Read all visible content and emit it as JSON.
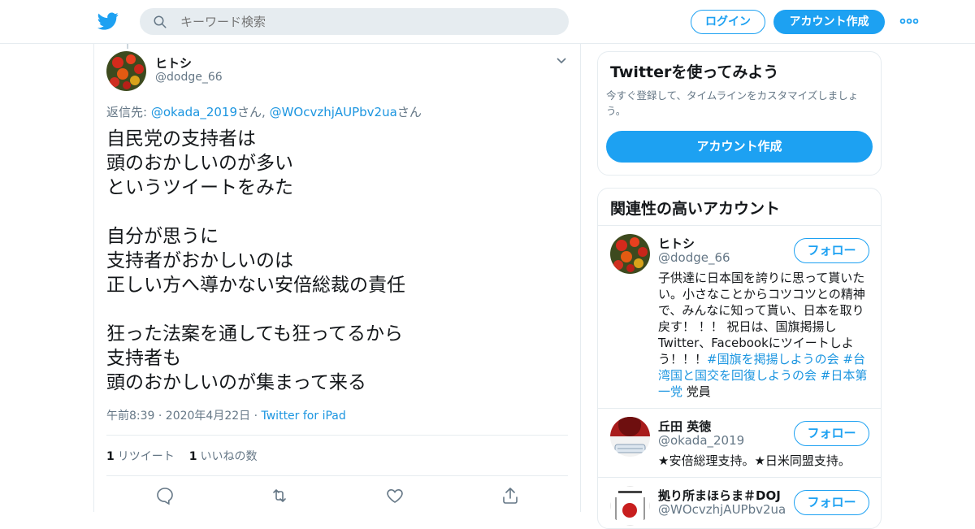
{
  "colors": {
    "accent": "#1da1f2",
    "link": "#1b95e0",
    "secondary_text": "#657786",
    "border": "#e6ecf0"
  },
  "header": {
    "logo_icon": "twitter-bird-icon",
    "search_placeholder": "キーワード検索",
    "login_label": "ログイン",
    "signup_label": "アカウント作成",
    "more_icon": "more-dots-icon"
  },
  "tweet": {
    "author_name": "ヒトシ",
    "author_handle": "@dodge_66",
    "reply_prefix": "返信先: ",
    "reply_user1": "@okada_2019",
    "reply_san1": "さん, ",
    "reply_user2": "@WOcvzhjAUPbv2ua",
    "reply_san2": "さん",
    "text": "自民党の支持者は\n頭のおかしいのが多い\nというツイートをみた\n\n自分が思うに\n支持者がおかしいのは\n正しい方へ導かない安倍総裁の責任\n\n狂った法案を通しても狂ってるから\n支持者も\n頭のおかしいのが集まって来る",
    "timestamp": "午前8:39 · 2020年4月22日 · ",
    "source": "Twitter for iPad",
    "retweet_count": "1",
    "retweet_label": "リツイート",
    "like_count": "1",
    "like_label": "いいねの数",
    "actions": [
      "reply-icon",
      "retweet-icon",
      "like-icon",
      "share-icon"
    ]
  },
  "signup_card": {
    "title": "Twitterを使ってみよう",
    "subtitle": "今すぐ登録して、タイムラインをカスタマイズしましょう。",
    "button_label": "アカウント作成"
  },
  "related": {
    "title": "関連性の高いアカウント",
    "follow_label": "フォロー",
    "accounts": [
      {
        "name": "ヒトシ",
        "handle": "@dodge_66",
        "bio_text": "子供達に日本国を誇りに思って貰いたい。小さなことからコツコツとの精神で、みんなに知って貰い、日本を取り戻す！ ！！ 祝日は、国旗掲揚し Twitter、Facebookにツイートしよう！！！",
        "bio_tag1": "#国旗を掲揚しようの会",
        "bio_tag2": "#台湾国と国交を回復しようの会",
        "bio_tag3": "#日本第一党",
        "bio_suffix": " 党員"
      },
      {
        "name": "丘田 英徳",
        "handle": "@okada_2019",
        "bio_text": "★安倍総理支持。★日米同盟支持。"
      },
      {
        "name": "拠り所まほらま＃DOJ",
        "handle": "@WOcvzhjAUPbv2ua"
      }
    ]
  }
}
